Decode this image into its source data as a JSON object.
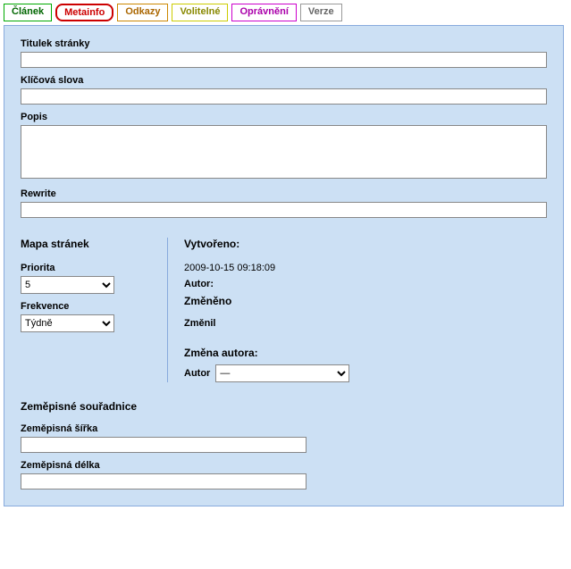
{
  "tabs": {
    "clanek": "Článek",
    "metainfo": "Metainfo",
    "odkazy": "Odkazy",
    "volitelne": "Volitelné",
    "opravneni": "Oprávnění",
    "verze": "Verze"
  },
  "fields": {
    "titulek_label": "Titulek stránky",
    "titulek_value": "",
    "klicova_label": "Klíčová slova",
    "klicova_value": "",
    "popis_label": "Popis",
    "popis_value": "",
    "rewrite_label": "Rewrite",
    "rewrite_value": ""
  },
  "sitemap": {
    "head": "Mapa stránek",
    "priorita_label": "Priorita",
    "priorita_value": "5",
    "frekvence_label": "Frekvence",
    "frekvence_value": "Týdně"
  },
  "meta": {
    "vytvoreno_label": "Vytvořeno:",
    "vytvoreno_value": "2009-10-15 09:18:09",
    "autor_label": "Autor:",
    "zmeneno_label": "Změněno",
    "zmenil_label": "Změnil",
    "zmena_autora_label": "Změna autora:",
    "autor_field_label": "Autor",
    "autor_select_value": "—"
  },
  "geo": {
    "head": "Zeměpisné souřadnice",
    "sirka_label": "Zeměpisná šířka",
    "sirka_value": "",
    "delka_label": "Zeměpisná délka",
    "delka_value": ""
  }
}
